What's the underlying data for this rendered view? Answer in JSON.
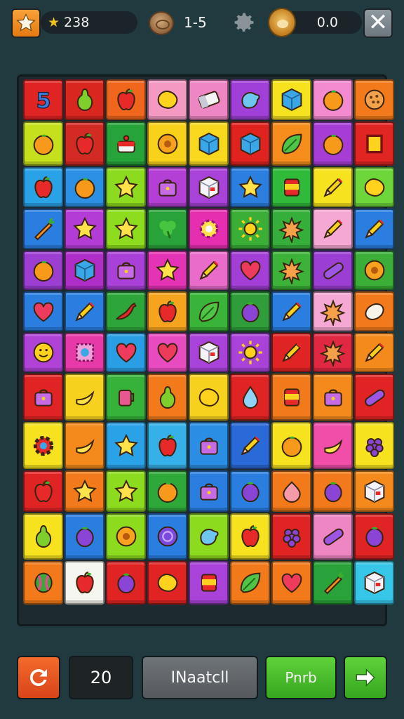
{
  "top_bar": {
    "star_icon": "star-icon",
    "coins": "238",
    "coin_icon": "coin-star-icon",
    "wood_icon": "wood-log-icon",
    "level": "1-5",
    "settings_icon": "gear-icon",
    "monkey_icon": "monkey-icon",
    "score": "0.0",
    "close_icon": "close-icon"
  },
  "board": {
    "rows": [
      [
        {
          "c": "#e02424",
          "i": "five"
        },
        {
          "c": "#d9261f",
          "i": "pear"
        },
        {
          "c": "#f0661c",
          "i": "apple"
        },
        {
          "c": "#f49ac2",
          "i": "lemon"
        },
        {
          "c": "#ee86c4",
          "i": "eraser"
        },
        {
          "c": "#a040d8",
          "i": "blob"
        },
        {
          "c": "#f6e21e",
          "i": "cube"
        },
        {
          "c": "#f38ad0",
          "i": "orange"
        },
        {
          "c": "#f27a1a",
          "i": "cookie"
        }
      ],
      [
        {
          "c": "#c6e01e",
          "i": "orange"
        },
        {
          "c": "#d42a24",
          "i": "apple"
        },
        {
          "c": "#26a43a",
          "i": "cake"
        },
        {
          "c": "#f7d11a",
          "i": "donut"
        },
        {
          "c": "#f7d81e",
          "i": "cube"
        },
        {
          "c": "#e0231f",
          "i": "cube"
        },
        {
          "c": "#f58c1c",
          "i": "leaf"
        },
        {
          "c": "#a63ed6",
          "i": "orange"
        },
        {
          "c": "#e02522",
          "i": "frame"
        }
      ],
      [
        {
          "c": "#2aa2e8",
          "i": "apple"
        },
        {
          "c": "#2b8fe4",
          "i": "orange"
        },
        {
          "c": "#8ddb1e",
          "i": "star"
        },
        {
          "c": "#b43fd4",
          "i": "bag"
        },
        {
          "c": "#a842d8",
          "i": "box"
        },
        {
          "c": "#2a7fe0",
          "i": "star"
        },
        {
          "c": "#2fba3a",
          "i": "can"
        },
        {
          "c": "#f6e21e",
          "i": "pencil"
        },
        {
          "c": "#6dd63a",
          "i": "lemon"
        }
      ],
      [
        {
          "c": "#2a7ee0",
          "i": "carrot"
        },
        {
          "c": "#b43cd6",
          "i": "star"
        },
        {
          "c": "#8ddd1e",
          "i": "star"
        },
        {
          "c": "#2aa23a",
          "i": "clover"
        },
        {
          "c": "#e52fb0",
          "i": "flower"
        },
        {
          "c": "#3aae36",
          "i": "sun"
        },
        {
          "c": "#36ae3a",
          "i": "splat"
        },
        {
          "c": "#f6a8d4",
          "i": "pencil"
        },
        {
          "c": "#2a7ee0",
          "i": "pencil"
        }
      ],
      [
        {
          "c": "#9c3ed2",
          "i": "orange"
        },
        {
          "c": "#b02ec8",
          "i": "cube"
        },
        {
          "c": "#a940d8",
          "i": "bag"
        },
        {
          "c": "#e433b4",
          "i": "star"
        },
        {
          "c": "#e96ccb",
          "i": "pencil"
        },
        {
          "c": "#a33ed6",
          "i": "heart"
        },
        {
          "c": "#3cb338",
          "i": "splat"
        },
        {
          "c": "#9a3ed4",
          "i": "pill"
        },
        {
          "c": "#3aae36",
          "i": "donut"
        }
      ],
      [
        {
          "c": "#2a7ee0",
          "i": "heart"
        },
        {
          "c": "#2a7ee0",
          "i": "pencil"
        },
        {
          "c": "#2ea53a",
          "i": "chili"
        },
        {
          "c": "#f6a41e",
          "i": "apple"
        },
        {
          "c": "#39b438",
          "i": "leaf"
        },
        {
          "c": "#2f9e3a",
          "i": "plum"
        },
        {
          "c": "#2a7ee0",
          "i": "pencil"
        },
        {
          "c": "#f6a8d4",
          "i": "splat"
        },
        {
          "c": "#f27a1a",
          "i": "egg"
        }
      ],
      [
        {
          "c": "#b142d8",
          "i": "smile"
        },
        {
          "c": "#e73aa8",
          "i": "stamp"
        },
        {
          "c": "#2a9ee4",
          "i": "heart"
        },
        {
          "c": "#e84bc0",
          "i": "heart"
        },
        {
          "c": "#a842d8",
          "i": "box"
        },
        {
          "c": "#a842d8",
          "i": "sun"
        },
        {
          "c": "#e02424",
          "i": "pencil"
        },
        {
          "c": "#e02842",
          "i": "splat"
        },
        {
          "c": "#f58a1c",
          "i": "pencil"
        }
      ],
      [
        {
          "c": "#e02424",
          "i": "bag"
        },
        {
          "c": "#f6d21e",
          "i": "banana"
        },
        {
          "c": "#36b23a",
          "i": "cup"
        },
        {
          "c": "#f27a1a",
          "i": "pear"
        },
        {
          "c": "#f6d21e",
          "i": "lemon"
        },
        {
          "c": "#e02424",
          "i": "drop"
        },
        {
          "c": "#f27a1a",
          "i": "can"
        },
        {
          "c": "#f58a1c",
          "i": "bag"
        },
        {
          "c": "#e02424",
          "i": "pill"
        }
      ],
      [
        {
          "c": "#f6e21e",
          "i": "gear"
        },
        {
          "c": "#f58a1c",
          "i": "banana"
        },
        {
          "c": "#2aa2e8",
          "i": "star"
        },
        {
          "c": "#36b0e8",
          "i": "apple"
        },
        {
          "c": "#2a8fe4",
          "i": "bag"
        },
        {
          "c": "#2a6ad8",
          "i": "pencil"
        },
        {
          "c": "#f6e21e",
          "i": "orange"
        },
        {
          "c": "#f04ea8",
          "i": "banana"
        },
        {
          "c": "#f6e21e",
          "i": "grapes"
        }
      ],
      [
        {
          "c": "#e02424",
          "i": "apple"
        },
        {
          "c": "#f27a1a",
          "i": "star"
        },
        {
          "c": "#8ddb1e",
          "i": "star"
        },
        {
          "c": "#2fa83a",
          "i": "orange"
        },
        {
          "c": "#2a7ee0",
          "i": "bag"
        },
        {
          "c": "#2a7ee0",
          "i": "plum"
        },
        {
          "c": "#f27a1a",
          "i": "onion"
        },
        {
          "c": "#f27a1a",
          "i": "plum"
        },
        {
          "c": "#f58a1c",
          "i": "box"
        }
      ],
      [
        {
          "c": "#f6e21e",
          "i": "pear"
        },
        {
          "c": "#2a7ee0",
          "i": "plum"
        },
        {
          "c": "#8ddb1e",
          "i": "donut"
        },
        {
          "c": "#2a7ee0",
          "i": "orb"
        },
        {
          "c": "#8ddb1e",
          "i": "blob"
        },
        {
          "c": "#f6e21e",
          "i": "apple"
        },
        {
          "c": "#e02424",
          "i": "grapes"
        },
        {
          "c": "#ee86c4",
          "i": "pill"
        },
        {
          "c": "#e02424",
          "i": "plum"
        }
      ],
      [
        {
          "c": "#f27a1a",
          "i": "melon"
        },
        {
          "c": "#f6f6f0",
          "i": "apple"
        },
        {
          "c": "#e02424",
          "i": "plum"
        },
        {
          "c": "#e02424",
          "i": "lemon"
        },
        {
          "c": "#a842d8",
          "i": "can"
        },
        {
          "c": "#f27a1a",
          "i": "leaf"
        },
        {
          "c": "#f27a1a",
          "i": "heart"
        },
        {
          "c": "#2aa23a",
          "i": "carrot"
        },
        {
          "c": "#36c6e8",
          "i": "box"
        }
      ]
    ]
  },
  "bottom_bar": {
    "refresh_icon": "refresh-icon",
    "moves": "20",
    "action_label": "INaatcll",
    "play_label": "Pnrb",
    "next_icon": "arrow-right-icon"
  }
}
